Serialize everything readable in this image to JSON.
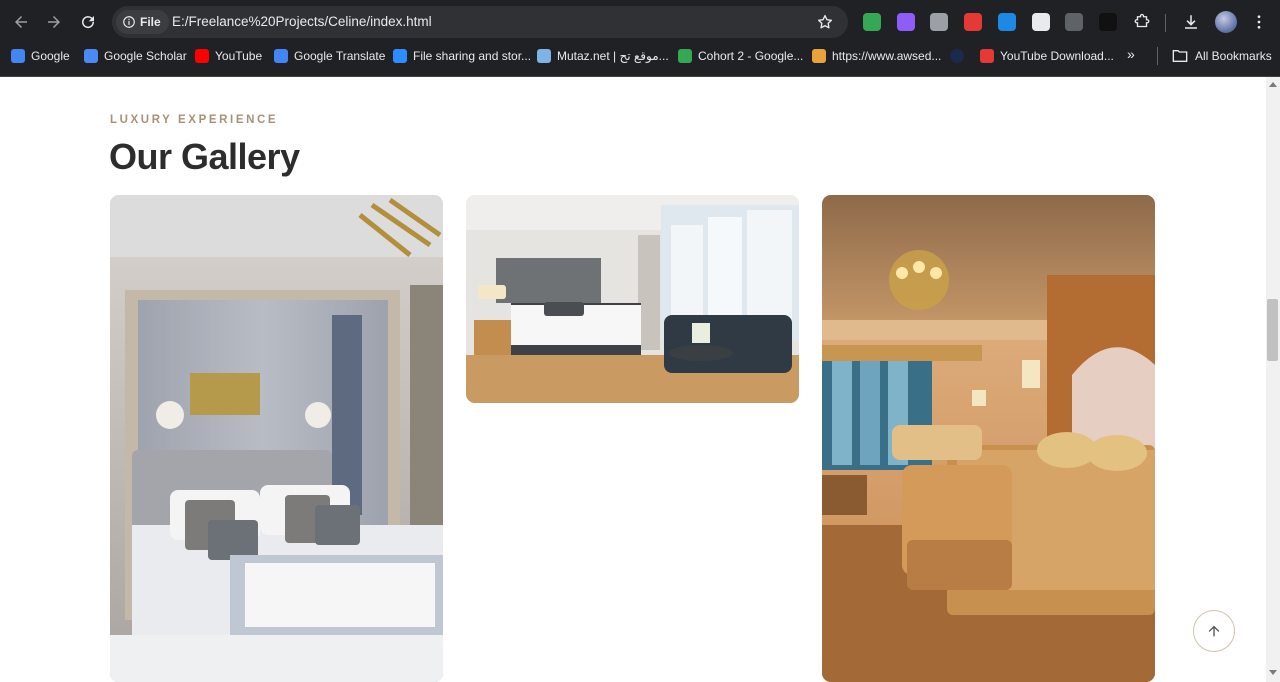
{
  "browser": {
    "url": "E:/Freelance%20Projects/Celine/index.html",
    "scheme_chip": "File",
    "bookmarks": [
      {
        "label": "Google",
        "color": "#4285f4"
      },
      {
        "label": "Google Scholar",
        "color": "#4a8af4"
      },
      {
        "label": "YouTube",
        "color": "#ff0000"
      },
      {
        "label": "Google Translate",
        "color": "#4285f4"
      },
      {
        "label": "File sharing and stor...",
        "color": "#2d8cff"
      },
      {
        "label": "Mutaz.net | موقع تح...",
        "color": "#7cb3e8"
      },
      {
        "label": "Cohort 2 - Google...",
        "color": "#34a853"
      },
      {
        "label": "https://www.awsed...",
        "color": "#e8a33a"
      },
      {
        "label": "",
        "color": "#1a2a4a"
      },
      {
        "label": "YouTube Download...",
        "color": "#e53935"
      }
    ],
    "all_bookmarks_label": "All Bookmarks",
    "extension_colors": [
      "#34a853",
      "#8e5cf7",
      "#9aa0a6",
      "#e53935",
      "#1e88e5",
      "#e8eaed",
      "#5f6368",
      "#111111"
    ]
  },
  "section": {
    "eyebrow": "LUXURY EXPERIENCE",
    "title": "Our Gallery"
  },
  "gallery": [
    {
      "name": "modern-grey-bedroom-image"
    },
    {
      "name": "city-view-hotel-room-image"
    },
    {
      "name": "classic-gold-suite-image"
    }
  ],
  "colors": {
    "accent": "#a89276",
    "heading": "#2d2d2d"
  }
}
